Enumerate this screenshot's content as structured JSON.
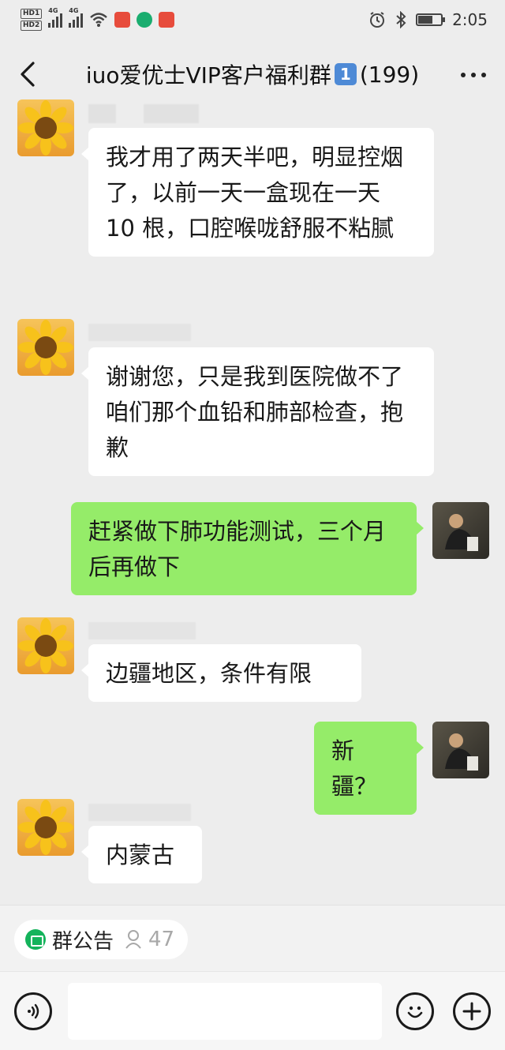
{
  "status_bar": {
    "hd1": "HD1",
    "hd2": "HD2",
    "net1": "4G",
    "net2": "4G",
    "time": "2:05",
    "icons": [
      "signal-icon",
      "wifi-icon",
      "alarm-icon",
      "bluetooth-icon",
      "battery-icon"
    ],
    "battery_level": 0.6
  },
  "header": {
    "title": "iuo爱优士VIP客户福利群",
    "badge": "1",
    "count": "(199)"
  },
  "messages": [
    {
      "side": "left",
      "text": "我才用了两天半吧，明显控烟了，以前一天一盒现在一天 10 根，口腔喉咙舒服不粘腻"
    },
    {
      "side": "left",
      "text": "谢谢您，只是我到医院做不了咱们那个血铅和肺部检查，抱歉"
    },
    {
      "side": "right",
      "text": "赶紧做下肺功能测试，三个月后再做下"
    },
    {
      "side": "left",
      "text": "边疆地区，条件有限"
    },
    {
      "side": "right",
      "text": "新疆？"
    },
    {
      "side": "left",
      "text": "内蒙古"
    }
  ],
  "announcement": {
    "label": "群公告",
    "member_count": "47"
  },
  "colors": {
    "background": "#ededed",
    "bubble_left": "#ffffff",
    "bubble_right": "#95ec69",
    "announce_icon": "#14b35b"
  }
}
